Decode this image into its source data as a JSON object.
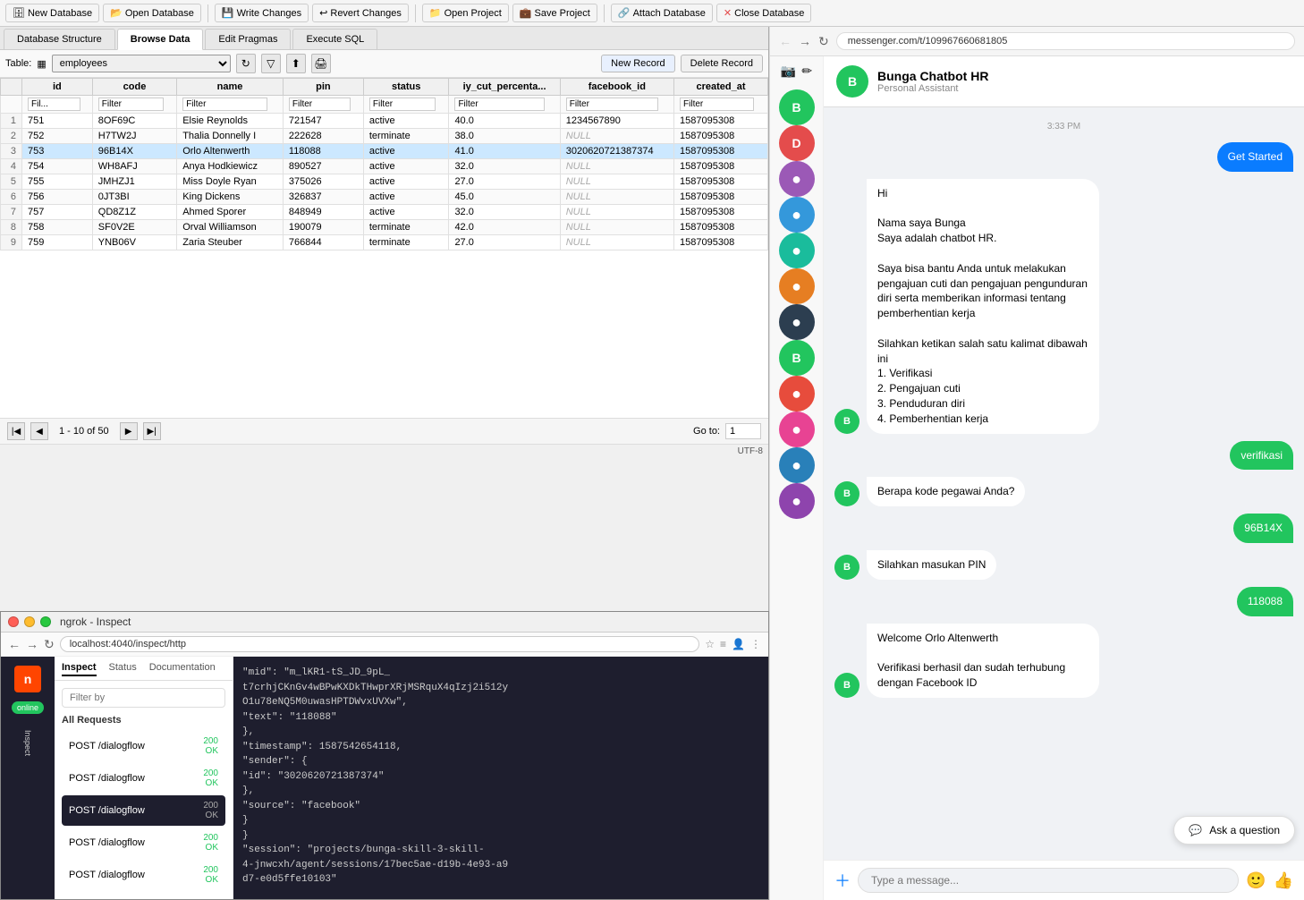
{
  "toolbar": {
    "new_database": "New Database",
    "open_database": "Open Database",
    "write_changes": "Write Changes",
    "revert_changes": "Revert Changes",
    "open_project": "Open Project",
    "save_project": "Save Project",
    "attach_database": "Attach Database",
    "close_database": "Close Database"
  },
  "tabs": {
    "database_structure": "Database Structure",
    "browse_data": "Browse Data",
    "edit_pragmas": "Edit Pragmas",
    "execute_sql": "Execute SQL"
  },
  "table": {
    "label": "Table:",
    "selected": "employees",
    "new_record": "New Record",
    "delete_record": "Delete Record",
    "columns": [
      "id",
      "code",
      "name",
      "pin",
      "status",
      "iy_cut_percenta...",
      "facebook_id",
      "created_at"
    ],
    "filters": [
      "Fil...",
      "Filter",
      "Filter",
      "Filter",
      "Filter",
      "Filter",
      "Filter",
      "Filter"
    ],
    "rows": [
      {
        "num": 1,
        "id": "751",
        "code": "8OF69C",
        "name": "Elsie Reynolds",
        "pin": "721547",
        "status": "active",
        "iy_cut": "40.0",
        "facebook_id": "1234567890",
        "created_at": "1587095308"
      },
      {
        "num": 2,
        "id": "752",
        "code": "H7TW2J",
        "name": "Thalia Donnelly I",
        "pin": "222628",
        "status": "terminate",
        "iy_cut": "38.0",
        "facebook_id": "NULL",
        "created_at": "1587095308"
      },
      {
        "num": 3,
        "id": "753",
        "code": "96B14X",
        "name": "Orlo Altenwerth",
        "pin": "118088",
        "status": "active",
        "iy_cut": "41.0",
        "facebook_id": "3020620721387374",
        "created_at": "1587095308"
      },
      {
        "num": 4,
        "id": "754",
        "code": "WH8AFJ",
        "name": "Anya Hodkiewicz",
        "pin": "890527",
        "status": "active",
        "iy_cut": "32.0",
        "facebook_id": "NULL",
        "created_at": "1587095308"
      },
      {
        "num": 5,
        "id": "755",
        "code": "JMHZJ1",
        "name": "Miss Doyle Ryan",
        "pin": "375026",
        "status": "active",
        "iy_cut": "27.0",
        "facebook_id": "NULL",
        "created_at": "1587095308"
      },
      {
        "num": 6,
        "id": "756",
        "code": "0JT3BI",
        "name": "King Dickens",
        "pin": "326837",
        "status": "active",
        "iy_cut": "45.0",
        "facebook_id": "NULL",
        "created_at": "1587095308"
      },
      {
        "num": 7,
        "id": "757",
        "code": "QD8Z1Z",
        "name": "Ahmed Sporer",
        "pin": "848949",
        "status": "active",
        "iy_cut": "32.0",
        "facebook_id": "NULL",
        "created_at": "1587095308"
      },
      {
        "num": 8,
        "id": "758",
        "code": "SF0V2E",
        "name": "Orval Williamson",
        "pin": "190079",
        "status": "terminate",
        "iy_cut": "42.0",
        "facebook_id": "NULL",
        "created_at": "1587095308"
      },
      {
        "num": 9,
        "id": "759",
        "code": "YNB06V",
        "name": "Zaria Steuber",
        "pin": "766844",
        "status": "terminate",
        "iy_cut": "27.0",
        "facebook_id": "NULL",
        "created_at": "1587095308"
      }
    ],
    "pagination": "1 - 10 of 50",
    "goto_label": "Go to:",
    "goto_value": "1",
    "encoding": "UTF-8"
  },
  "ngrok": {
    "title": "ngrok - Inspect",
    "url": "localhost:4040/inspect/http",
    "brand": "n",
    "status": "online",
    "tab_inspect": "Inspect",
    "tab_status": "Status",
    "tab_docs": "Documentation",
    "filter_placeholder": "Filter by",
    "section_title": "All Requests",
    "requests": [
      {
        "method": "POST /dialogflow",
        "status": "200",
        "status2": "OK"
      },
      {
        "method": "POST /dialogflow",
        "status": "200",
        "status2": "OK"
      },
      {
        "method": "POST /dialogflow",
        "status": "200",
        "status2": "OK",
        "selected": true
      },
      {
        "method": "POST /dialogflow",
        "status": "200",
        "status2": "OK"
      },
      {
        "method": "POST /dialogflow",
        "status": "200",
        "status2": "OK"
      }
    ],
    "json_content": [
      "\"mid\": \"m_lKR1-tS_JD_9pL_",
      "t7crhjCKnGv4wBPwKXDkTHwprXRjMSRquX4qIzj2i512y",
      "O1u78eNQ5M0uwasHPTDWvxUVXw\",",
      "  \"text\": \"118088\"",
      "},",
      "\"timestamp\": 1587542654118,",
      "\"sender\": {",
      "  \"id\": \"3020620721387374\"",
      "},",
      "\"source\": \"facebook\"",
      "}",
      "}",
      "\"session\": \"projects/bunga-skill-3-skill-",
      "4-jnwcxh/agent/sessions/17bec5ae-d19b-4e93-a9",
      "d7-e0d5ffe10103\""
    ]
  },
  "chat": {
    "url": "messenger.com/t/109967660681805",
    "header_name": "Bunga Chatbot HR",
    "header_sub": "Personal Assistant",
    "time_stamp": "3:33 PM",
    "messages": [
      {
        "type": "user",
        "text": "Get Started",
        "style": "blue"
      },
      {
        "type": "bot",
        "text": "Hi\n\nNama saya Bunga\nSaya adalah chatbot HR.\n\nSaya bisa bantu Anda untuk melakukan pengajuan cuti dan pengajuan pengunduran diri serta memberikan informasi tentang pemberhentian kerja\n\nSilahkan ketikan salah satu kalimat dibawah ini\n1. Verifikasi\n2. Pengajuan cuti\n3. Penduduran diri\n4. Pemberhentian kerja"
      },
      {
        "type": "user",
        "text": "verifikasi",
        "style": "green"
      },
      {
        "type": "bot",
        "text": "Berapa kode pegawai Anda?"
      },
      {
        "type": "user",
        "text": "96B14X",
        "style": "green"
      },
      {
        "type": "bot",
        "text": "Silahkan masukan PIN"
      },
      {
        "type": "user",
        "text": "118088",
        "style": "green"
      },
      {
        "type": "bot",
        "text": "Welcome Orlo Altenwerth\n\nVerifikasi berhasil dan sudah terhubung dengan Facebook ID"
      }
    ],
    "input_placeholder": "Type a message...",
    "ask_question": "Ask a question"
  },
  "contacts": [
    {
      "initial": "B",
      "color": "#22c55e",
      "label": "Bunga HR"
    },
    {
      "initial": "D",
      "color": "#e44c4c",
      "label": "D"
    },
    {
      "initial": "",
      "color": "#9b59b6",
      "label": "avatar3",
      "avatar": true
    },
    {
      "initial": "",
      "color": "#3498db",
      "label": "avatar4",
      "avatar": true
    },
    {
      "initial": "",
      "color": "#1abc9c",
      "label": "avatar5",
      "avatar": true
    },
    {
      "initial": "",
      "color": "#e67e22",
      "label": "avatar6",
      "avatar": true
    },
    {
      "initial": "",
      "color": "#2c3e50",
      "label": "avatar7",
      "avatar": true
    },
    {
      "initial": "B",
      "color": "#22c55e",
      "label": "B"
    },
    {
      "initial": "",
      "color": "#e74c3c",
      "label": "avatar9",
      "avatar": true
    },
    {
      "initial": "",
      "color": "#16a085",
      "label": "avatar10",
      "avatar": true
    },
    {
      "initial": "",
      "color": "#2980b9",
      "label": "avatar11",
      "avatar": true
    },
    {
      "initial": "",
      "color": "#8e44ad",
      "label": "avatar12",
      "avatar": true
    }
  ]
}
